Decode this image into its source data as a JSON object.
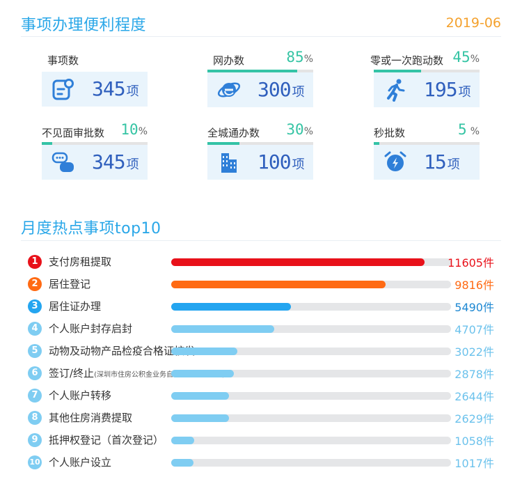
{
  "header": {
    "title": "事项办理便利程度",
    "date": "2019-06"
  },
  "stats": [
    {
      "label": "事项数",
      "percent": null,
      "value": "345",
      "unit": "项",
      "icon": "document-icon"
    },
    {
      "label": "网办数",
      "percent": "85",
      "value": "300",
      "unit": "项",
      "icon": "ie-browser-icon"
    },
    {
      "label": "零或一次跑动数",
      "percent": "45",
      "value": "195",
      "unit": "项",
      "icon": "running-person-icon"
    },
    {
      "label": "不见面审批数",
      "percent": "10",
      "value": "345",
      "unit": "项",
      "icon": "chat-icon"
    },
    {
      "label": "全城通办数",
      "percent": "30",
      "value": "100",
      "unit": "项",
      "icon": "city-buildings-icon"
    },
    {
      "label": "秒批数",
      "percent": "5",
      "value": "15",
      "unit": "项",
      "icon": "alarm-clock-icon"
    }
  ],
  "percent_sign": "%",
  "top10": {
    "title": "月度热点事项top10",
    "unit": "件",
    "max": 12800,
    "colors": [
      "#e8111a",
      "#ff6a13",
      "#24a5f0",
      "#7fcdf2"
    ],
    "items": [
      {
        "rank": "1",
        "name": "支付房租提取",
        "note": "",
        "count": "11605"
      },
      {
        "rank": "2",
        "name": "居住登记",
        "note": "",
        "count": "9816"
      },
      {
        "rank": "3",
        "name": "居住证办理",
        "note": "",
        "count": "5490"
      },
      {
        "rank": "4",
        "name": "个人账户封存启封",
        "note": "",
        "count": "4707"
      },
      {
        "rank": "5",
        "name": "动物及动物产品检疫合格证核发",
        "note": "",
        "count": "3022"
      },
      {
        "rank": "6",
        "name": "签订/终止",
        "note": "(深圳市住房公积金业务自助办理服务协议)",
        "count": "2878"
      },
      {
        "rank": "7",
        "name": "个人账户转移",
        "note": "",
        "count": "2644"
      },
      {
        "rank": "8",
        "name": "其他住房消费提取",
        "note": "",
        "count": "2629"
      },
      {
        "rank": "9",
        "name": "抵押权登记（首次登记）",
        "note": "",
        "count": "1058"
      },
      {
        "rank": "10",
        "name": "个人账户设立",
        "note": "",
        "count": "1017"
      }
    ]
  }
}
